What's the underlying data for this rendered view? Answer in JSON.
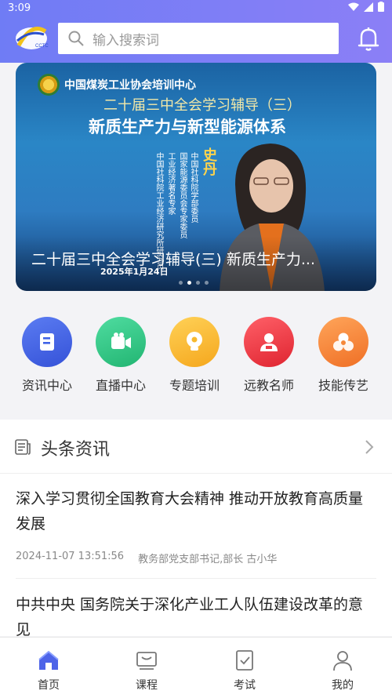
{
  "status_bar": {
    "time": "3:09"
  },
  "search": {
    "placeholder": "输入搜索词"
  },
  "banner": {
    "org": "中国煤炭工业协会培训中心",
    "subtitle": "二十届三中全会学习辅导（三）",
    "headline": "新质生产力与新型能源体系",
    "speaker": "史丹",
    "titles": [
      "中国社科院学部委员",
      "国家能源委员会专家委员",
      "工业经济著名专家",
      "中国社科院工业经济研究所研究员"
    ],
    "caption": "二十届三中全会学习辅导(三)  新质生产力...",
    "date": "2025年1月24日",
    "dots": 4,
    "active_dot": 1
  },
  "features": [
    {
      "label": "资讯中心",
      "icon": "news-icon",
      "color": "#3f62e6"
    },
    {
      "label": "直播中心",
      "icon": "live-camera-icon",
      "color": "#2fc585"
    },
    {
      "label": "专题培训",
      "icon": "bulb-icon",
      "color": "#f7b92e"
    },
    {
      "label": "远教名师",
      "icon": "teacher-icon",
      "color": "#ee3b46"
    },
    {
      "label": "技能传艺",
      "icon": "skill-icon",
      "color": "#f5883a"
    }
  ],
  "news": {
    "section_title": "头条资讯",
    "items": [
      {
        "title": "深入学习贯彻全国教育大会精神 推动开放教育高质量发展",
        "date": "2024-11-07 13:51:56",
        "author": "教务部党支部书记,部长 古小华"
      },
      {
        "title": "中共中央 国务院关于深化产业工人队伍建设改革的意见"
      }
    ]
  },
  "tabbar": [
    {
      "label": "首页",
      "icon": "home-icon",
      "active": true
    },
    {
      "label": "课程",
      "icon": "course-icon",
      "active": false
    },
    {
      "label": "考试",
      "icon": "exam-icon",
      "active": false
    },
    {
      "label": "我的",
      "icon": "user-icon",
      "active": false
    }
  ],
  "colors": {
    "header_start": "#6f7cf5",
    "header_end": "#8b7ff6",
    "tab_active": "#4e64e8"
  }
}
